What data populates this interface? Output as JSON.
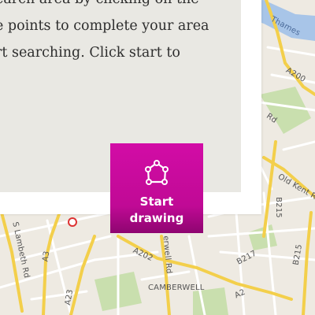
{
  "instructions": {
    "line1": "earch area by clicking on the",
    "line2": "e points to complete your area",
    "line3": "rt searching. Click start to"
  },
  "start_button": {
    "line1": "Start",
    "line2": "drawing",
    "icon": "polygon-draw-icon"
  },
  "map": {
    "labels": {
      "thames": "Thames",
      "a200": "A200",
      "rd": "Rd",
      "old_kent_rd": "Old Kent R",
      "b215_a": "B215",
      "b215_b": "B215",
      "s_lambeth_rd": "S Lambeth Rd",
      "a3": "A3",
      "a202": "A202",
      "erwell_rd": "erwell Rd",
      "b217": "B217",
      "a23": "A23",
      "camberwell": "CAMBERWELL",
      "a2": "A2"
    },
    "colors": {
      "land": "#eeeae2",
      "major_road": "#f6d65a",
      "road": "#ffffff",
      "water": "#a8c5e8",
      "park": "#c9dfae",
      "accent": "#c70a9c"
    }
  }
}
